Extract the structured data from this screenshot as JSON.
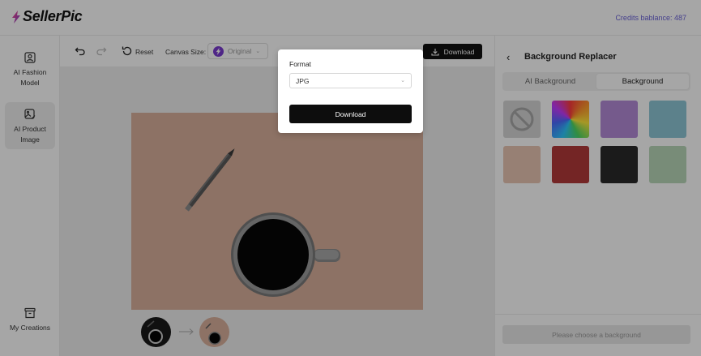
{
  "header": {
    "app_name": "SellerPic",
    "credits": "Credits bablance: 487"
  },
  "sidebar": {
    "items": [
      {
        "label": "AI Fashion Model",
        "icon": "user-square-icon"
      },
      {
        "label": "AI Product Image",
        "icon": "image-edit-icon",
        "active": true
      },
      {
        "label": "My Creations",
        "icon": "archive-icon"
      }
    ]
  },
  "toolbar": {
    "undo_icon": "undo-icon",
    "redo_icon": "redo-icon",
    "reset_label": "Reset",
    "canvas_size_label": "Canvas Size:",
    "canvas_size_value": "Original",
    "download_label": "Download"
  },
  "panel": {
    "title": "Background Replacer",
    "tabs": [
      {
        "label": "AI Background",
        "selected": false
      },
      {
        "label": "Background",
        "selected": true
      }
    ],
    "swatches": [
      {
        "name": "none",
        "color": "#d6d6d6"
      },
      {
        "name": "rainbow",
        "color": "conic"
      },
      {
        "name": "purple",
        "color": "#b48ad8"
      },
      {
        "name": "sky-blue",
        "color": "#8ec6d6"
      },
      {
        "name": "peach",
        "color": "#e9c5b2"
      },
      {
        "name": "red",
        "color": "#b23a3a"
      },
      {
        "name": "black",
        "color": "#2a2a2a"
      },
      {
        "name": "sage-green",
        "color": "#b8d8b8"
      }
    ],
    "choose_hint": "Please choose a background"
  },
  "modal": {
    "format_label": "Format",
    "format_value": "JPG",
    "download_label": "Download"
  },
  "colors": {
    "accent": "#6a62d8",
    "canvas_bg": "#d9b09b",
    "primary_button": "#111111"
  }
}
